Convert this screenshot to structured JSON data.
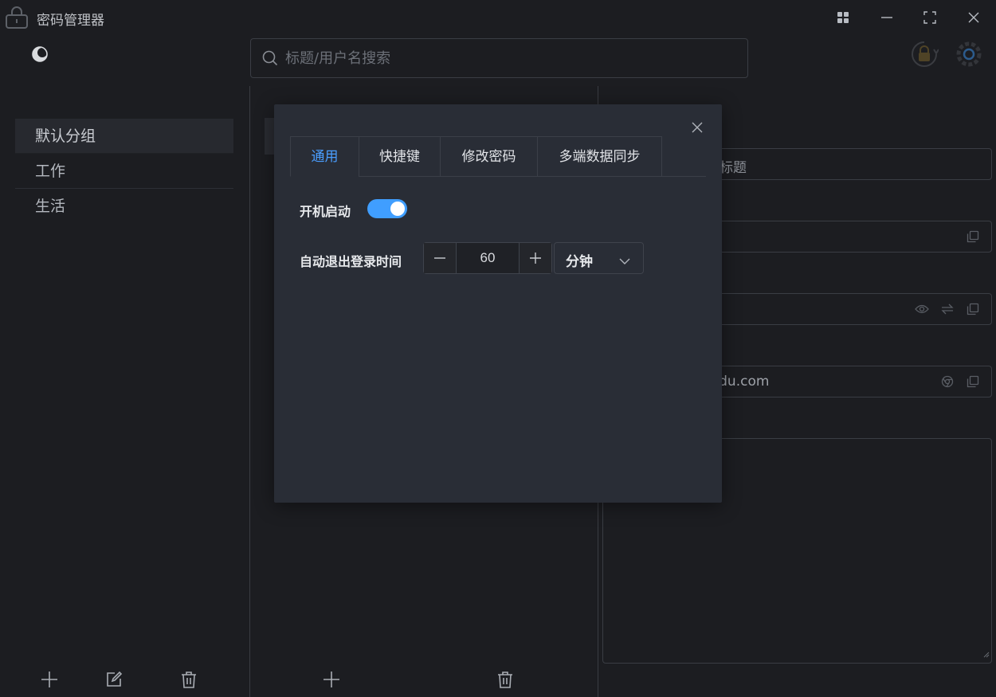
{
  "window": {
    "title": "密码管理器",
    "icons": {
      "app": "lock-icon",
      "grid": "grid-icon",
      "minimize": "minimize-icon",
      "maximize": "maximize-icon",
      "close": "close-icon"
    }
  },
  "sidebar": {
    "theme_icon": "moon-icon",
    "groups": [
      {
        "label": "默认分组",
        "active": true
      },
      {
        "label": "工作",
        "active": false
      },
      {
        "label": "生活",
        "active": false
      }
    ],
    "actions": [
      "add-icon",
      "edit-icon",
      "delete-icon"
    ]
  },
  "search": {
    "placeholder": "标题/用户名搜索",
    "value": ""
  },
  "toolbar": {
    "icons": [
      "lock-timer-icon",
      "settings-gear-icon"
    ]
  },
  "list": {
    "actions": [
      "add-icon",
      "delete-icon"
    ]
  },
  "detail": {
    "title_placeholder_visible": "标题",
    "url_visible": "aidu.com"
  },
  "settings_dialog": {
    "tabs": [
      {
        "label": "通用",
        "active": true
      },
      {
        "label": "快捷键",
        "active": false
      },
      {
        "label": "修改密码",
        "active": false
      },
      {
        "label": "多端数据同步",
        "active": false
      }
    ],
    "autostart": {
      "label": "开机启动",
      "enabled": true
    },
    "auto_logout": {
      "label": "自动退出登录时间",
      "value": "60",
      "unit": "分钟"
    }
  },
  "colors": {
    "background": "#1c1d21",
    "dialog": "#292d36",
    "accent": "#409eff",
    "active_tab": "#4a9eff"
  }
}
